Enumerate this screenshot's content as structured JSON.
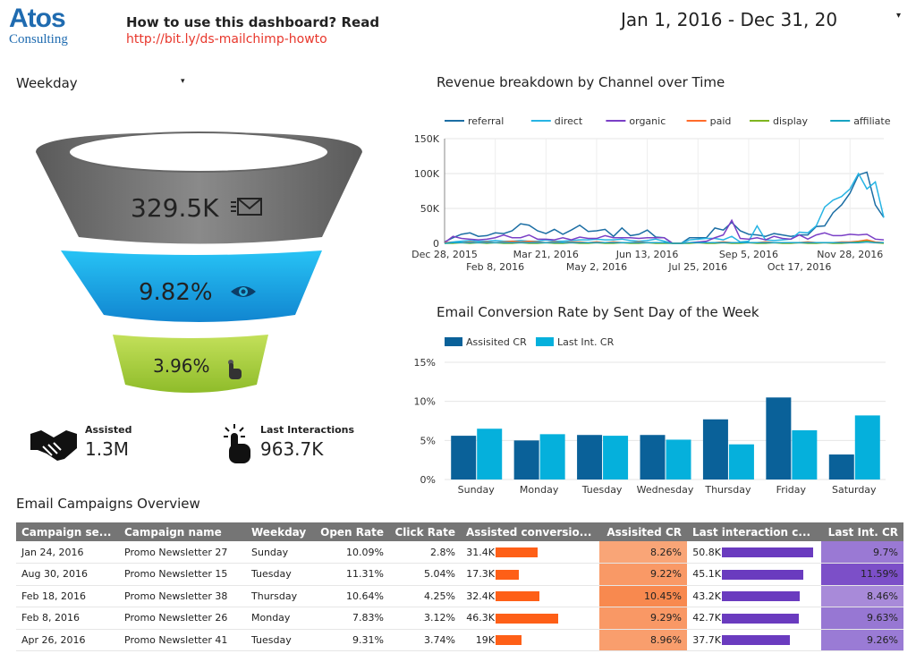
{
  "header": {
    "logo_line1": "Atos",
    "logo_line2": "Consulting",
    "howto": "How to use this dashboard? Read",
    "link": "http://bit.ly/ds-mailchimp-howto",
    "date_range": "Jan 1, 2016 - Dec 31, 20",
    "date_caret": "▾"
  },
  "filter": {
    "label": "Weekday",
    "caret": "▾"
  },
  "funnel": {
    "sent": "329.5K",
    "sent_icon": "envelope-icon",
    "open_rate": "9.82%",
    "open_icon": "eye-icon",
    "click_rate": "3.96%",
    "click_icon": "pointer-hand-icon",
    "colors": {
      "top": "#6e6e6e",
      "middle": "#1fa7e8",
      "bottom": "#a6cf3a"
    }
  },
  "kpis": {
    "assisted_label": "Assisted",
    "assisted_value": "1.3M",
    "last_label": "Last Interactions",
    "last_value": "963.7K"
  },
  "chart_data": [
    {
      "type": "line",
      "title": "Revenue breakdown by Channel over Time",
      "legend_position": "top",
      "grid": true,
      "x_ticks": [
        "Dec 28, 2015",
        "Feb 8, 2016",
        "Mar 21, 2016",
        "May 2, 2016",
        "Jun 13, 2016",
        "Jul 25, 2016",
        "Sep 5, 2016",
        "Oct 17, 2016",
        "Nov 28, 2016"
      ],
      "y_ticks": [
        "0",
        "50K",
        "100K",
        "150K"
      ],
      "ylim": [
        0,
        150000
      ],
      "x_start": "Dec 28, 2015",
      "x_interval": "weekly",
      "series": [
        {
          "name": "referral",
          "color": "#1c6ea4",
          "values": [
            2,
            8,
            13,
            15,
            10,
            11,
            15,
            14,
            18,
            28,
            26,
            18,
            14,
            20,
            13,
            19,
            26,
            17,
            18,
            20,
            10,
            22,
            11,
            13,
            19,
            9,
            8,
            0,
            0,
            8,
            8,
            8,
            22,
            19,
            30,
            18,
            13,
            12,
            10,
            14,
            12,
            10,
            12,
            12,
            24,
            25,
            44,
            55,
            72,
            98,
            102,
            55,
            37
          ]
        },
        {
          "name": "direct",
          "color": "#27b4e4",
          "values": [
            1,
            2,
            3,
            4,
            3,
            3,
            4,
            3,
            3,
            4,
            3,
            3,
            5,
            3,
            3,
            4,
            5,
            5,
            6,
            5,
            5,
            6,
            4,
            3,
            4,
            6,
            3,
            0,
            0,
            5,
            6,
            7,
            7,
            5,
            10,
            2,
            3,
            25,
            5,
            4,
            5,
            6,
            16,
            15,
            25,
            52,
            62,
            67,
            78,
            100,
            78,
            88,
            37
          ]
        },
        {
          "name": "organic",
          "color": "#7a3fc6",
          "values": [
            1,
            10,
            7,
            6,
            5,
            6,
            8,
            12,
            8,
            8,
            12,
            6,
            6,
            5,
            8,
            5,
            9,
            7,
            7,
            11,
            8,
            8,
            8,
            7,
            8,
            8,
            8,
            0,
            0,
            1,
            2,
            3,
            8,
            12,
            33,
            7,
            6,
            8,
            5,
            10,
            7,
            6,
            12,
            6,
            12,
            15,
            11,
            11,
            13,
            12,
            13,
            6,
            5
          ]
        },
        {
          "name": "paid",
          "color": "#ff6b2b",
          "values": [
            1,
            1,
            1,
            2,
            1,
            2,
            1,
            2,
            3,
            2,
            3,
            2,
            1,
            2,
            1,
            2,
            2,
            1,
            2,
            1,
            2,
            1,
            1,
            2,
            1,
            1,
            1,
            0,
            0,
            1,
            1,
            1,
            1,
            2,
            1,
            1,
            1,
            1,
            2,
            1,
            1,
            1,
            1,
            2,
            1,
            1,
            1,
            2,
            2,
            3,
            5,
            2,
            1
          ]
        },
        {
          "name": "display",
          "color": "#7fb520",
          "values": [
            0,
            0,
            1,
            0,
            1,
            0,
            1,
            0,
            0,
            1,
            0,
            0,
            1,
            0,
            0,
            1,
            0,
            0,
            1,
            0,
            0,
            1,
            0,
            0,
            1,
            0,
            0,
            0,
            0,
            0,
            1,
            0,
            0,
            1,
            0,
            0,
            1,
            0,
            0,
            1,
            0,
            0,
            1,
            0,
            0,
            1,
            0,
            0,
            1,
            2,
            3,
            1,
            0
          ]
        },
        {
          "name": "affiliate",
          "color": "#17a3c2",
          "values": [
            0,
            1,
            1,
            1,
            1,
            1,
            1,
            1,
            1,
            1,
            1,
            1,
            1,
            1,
            1,
            1,
            1,
            1,
            1,
            1,
            1,
            1,
            1,
            1,
            1,
            1,
            1,
            0,
            0,
            1,
            1,
            1,
            1,
            1,
            1,
            1,
            1,
            1,
            1,
            1,
            1,
            1,
            1,
            1,
            1,
            1,
            1,
            1,
            1,
            1,
            2,
            1,
            1
          ]
        }
      ]
    },
    {
      "type": "bar",
      "title": "Email Conversion Rate by Sent Day of the Week",
      "legend_position": "top-left",
      "grid": true,
      "categories": [
        "Sunday",
        "Monday",
        "Tuesday",
        "Wednesday",
        "Thursday",
        "Friday",
        "Saturday"
      ],
      "y_ticks": [
        "0%",
        "5%",
        "10%",
        "15%"
      ],
      "ylim": [
        0,
        15
      ],
      "series": [
        {
          "name": "Assisited CR",
          "color": "#0a6199",
          "values": [
            5.6,
            5.0,
            5.7,
            5.7,
            7.7,
            10.5,
            3.2
          ]
        },
        {
          "name": "Last Int. CR",
          "color": "#05b0dc",
          "values": [
            6.5,
            5.8,
            5.6,
            5.1,
            4.5,
            6.3,
            8.2
          ]
        }
      ]
    }
  ],
  "table": {
    "title": "Email Campaigns Overview",
    "headers": [
      "Campaign se...",
      "Campaign name",
      "Weekday",
      "Open Rate",
      "Click Rate",
      "Assisted conversio...",
      "Assisited CR",
      "Last interaction c...",
      "Last Int. CR"
    ],
    "rows": [
      {
        "date": "Jan 24, 2016",
        "name": "Promo Newsletter 27",
        "weekday": "Sunday",
        "open": "10.09%",
        "click": "2.8%",
        "assisted": "31.4K",
        "assisted_n": 31.4,
        "acr": "8.26%",
        "acr_color": "#f9a577",
        "last": "50.8K",
        "last_n": 50.8,
        "lcr": "9.7%",
        "lcr_color": "#9a79d4"
      },
      {
        "date": "Aug 30, 2016",
        "name": "Promo Newsletter 15",
        "weekday": "Tuesday",
        "open": "11.31%",
        "click": "5.04%",
        "assisted": "17.3K",
        "assisted_n": 17.3,
        "acr": "9.22%",
        "acr_color": "#f99966",
        "last": "45.1K",
        "last_n": 45.1,
        "lcr": "11.59%",
        "lcr_color": "#7c4fc8"
      },
      {
        "date": "Feb 18, 2016",
        "name": "Promo Newsletter 38",
        "weekday": "Thursday",
        "open": "10.64%",
        "click": "4.25%",
        "assisted": "32.4K",
        "assisted_n": 32.4,
        "acr": "10.45%",
        "acr_color": "#f8894f",
        "last": "43.2K",
        "last_n": 43.2,
        "lcr": "8.46%",
        "lcr_color": "#a88ad9"
      },
      {
        "date": "Feb 8, 2016",
        "name": "Promo Newsletter 26",
        "weekday": "Monday",
        "open": "7.83%",
        "click": "3.12%",
        "assisted": "46.3K",
        "assisted_n": 46.3,
        "acr": "9.29%",
        "acr_color": "#f99865",
        "last": "42.7K",
        "last_n": 42.7,
        "lcr": "9.63%",
        "lcr_color": "#9777d3"
      },
      {
        "date": "Apr 26, 2016",
        "name": "Promo Newsletter 41",
        "weekday": "Tuesday",
        "open": "9.31%",
        "click": "3.74%",
        "assisted": "19K",
        "assisted_n": 19,
        "acr": "8.96%",
        "acr_color": "#f99e6d",
        "last": "37.7K",
        "last_n": 37.7,
        "lcr": "9.26%",
        "lcr_color": "#9a7bd5"
      }
    ],
    "bar_colors": {
      "assisted": "#fe5f17",
      "last": "#6a3bbf"
    }
  }
}
